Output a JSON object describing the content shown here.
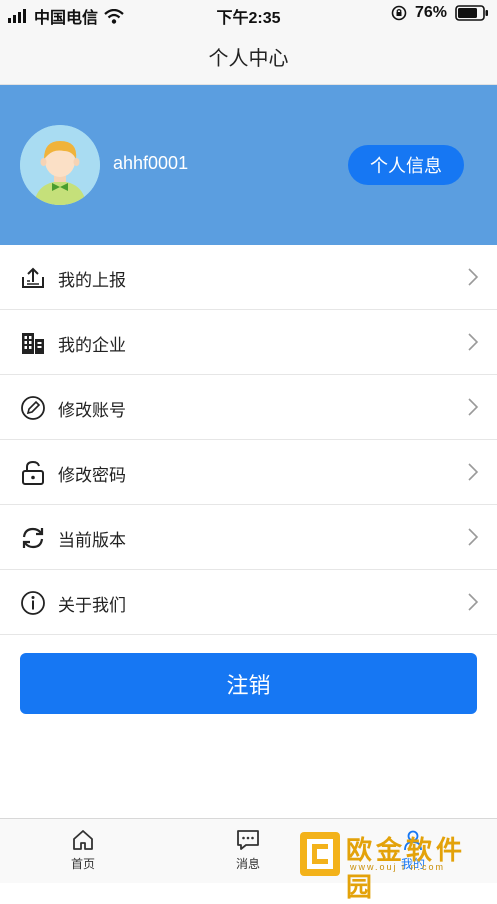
{
  "status_bar": {
    "carrier": "中国电信",
    "time": "下午2:35",
    "battery": "76%",
    "icons": [
      "signal-icon",
      "wifi-icon",
      "orientation-lock-icon",
      "battery-icon"
    ]
  },
  "header": {
    "title": "个人中心"
  },
  "profile": {
    "username": "ahhf0001",
    "info_button": "个人信息",
    "colors": {
      "banner": "#5b9ee0",
      "button": "#1677f3"
    }
  },
  "menu": {
    "items": [
      {
        "label": "我的上报",
        "icon": "upload-icon"
      },
      {
        "label": "我的企业",
        "icon": "building-icon"
      },
      {
        "label": "修改账号",
        "icon": "edit-pen-icon"
      },
      {
        "label": "修改密码",
        "icon": "unlock-icon"
      },
      {
        "label": "当前版本",
        "icon": "refresh-icon"
      },
      {
        "label": "关于我们",
        "icon": "info-icon"
      }
    ]
  },
  "logout_button": "注销",
  "tabbar": {
    "tabs": [
      {
        "label": "首页",
        "icon": "home-icon"
      },
      {
        "label": "消息",
        "icon": "message-icon"
      },
      {
        "label": "我的",
        "icon": "user-icon",
        "active": true
      }
    ]
  },
  "watermark": {
    "text": "欧金软件园",
    "url": "www.ouj i n.com"
  }
}
